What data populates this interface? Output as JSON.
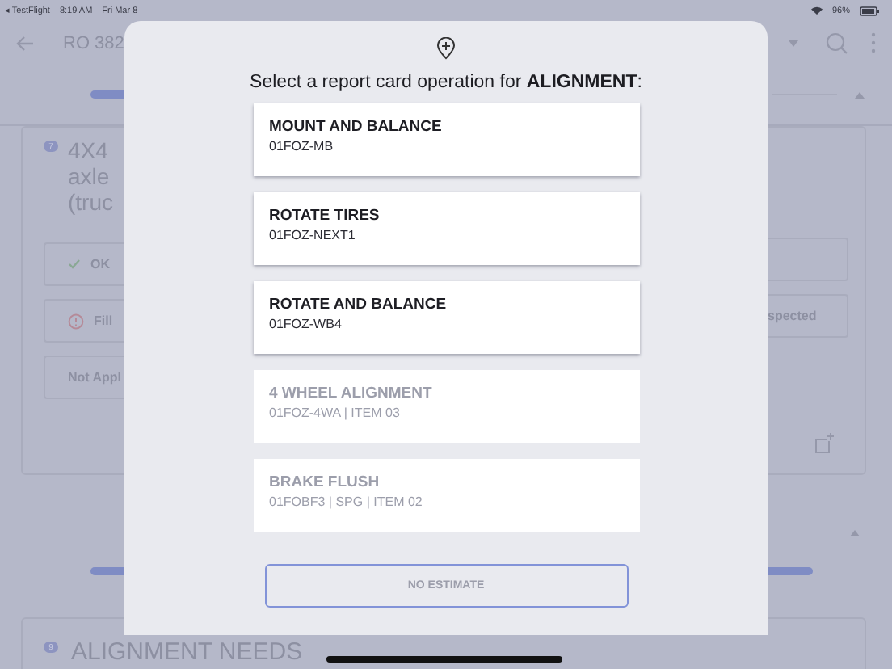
{
  "status_bar": {
    "back_app": "◂ TestFlight",
    "time": "8:19 AM",
    "date": "Fri Mar 8",
    "battery": "96%"
  },
  "header": {
    "title": "RO 382"
  },
  "items": [
    {
      "number": "7",
      "title_lines": [
        "4X4",
        "axle",
        "(truc"
      ],
      "choices": [
        {
          "kind": "ok",
          "label": "OK"
        },
        {
          "kind": "fill",
          "label": "Fill"
        },
        {
          "kind": "plain",
          "label": "Not Appl"
        }
      ],
      "right_choices": [
        "spected"
      ]
    },
    {
      "number": "9",
      "title": "ALIGNMENT NEEDS"
    }
  ],
  "modal": {
    "title": "Select a report card operation for **ALIGNMENT**:",
    "operations": [
      {
        "name": "MOUNT AND BALANCE",
        "code": "01FOZ-MB",
        "disabled": false
      },
      {
        "name": "ROTATE TIRES",
        "code": "01FOZ-NEXT1",
        "disabled": false
      },
      {
        "name": "ROTATE AND BALANCE",
        "code": "01FOZ-WB4",
        "disabled": false
      },
      {
        "name": "4 WHEEL ALIGNMENT",
        "code": "01FOZ-4WA | ITEM 03",
        "disabled": true
      },
      {
        "name": "BRAKE FLUSH",
        "code": "01FOBF3 | SPG | ITEM 02",
        "disabled": true
      }
    ],
    "button": {
      "label": "NO ESTIMATE",
      "disabled": true
    }
  }
}
